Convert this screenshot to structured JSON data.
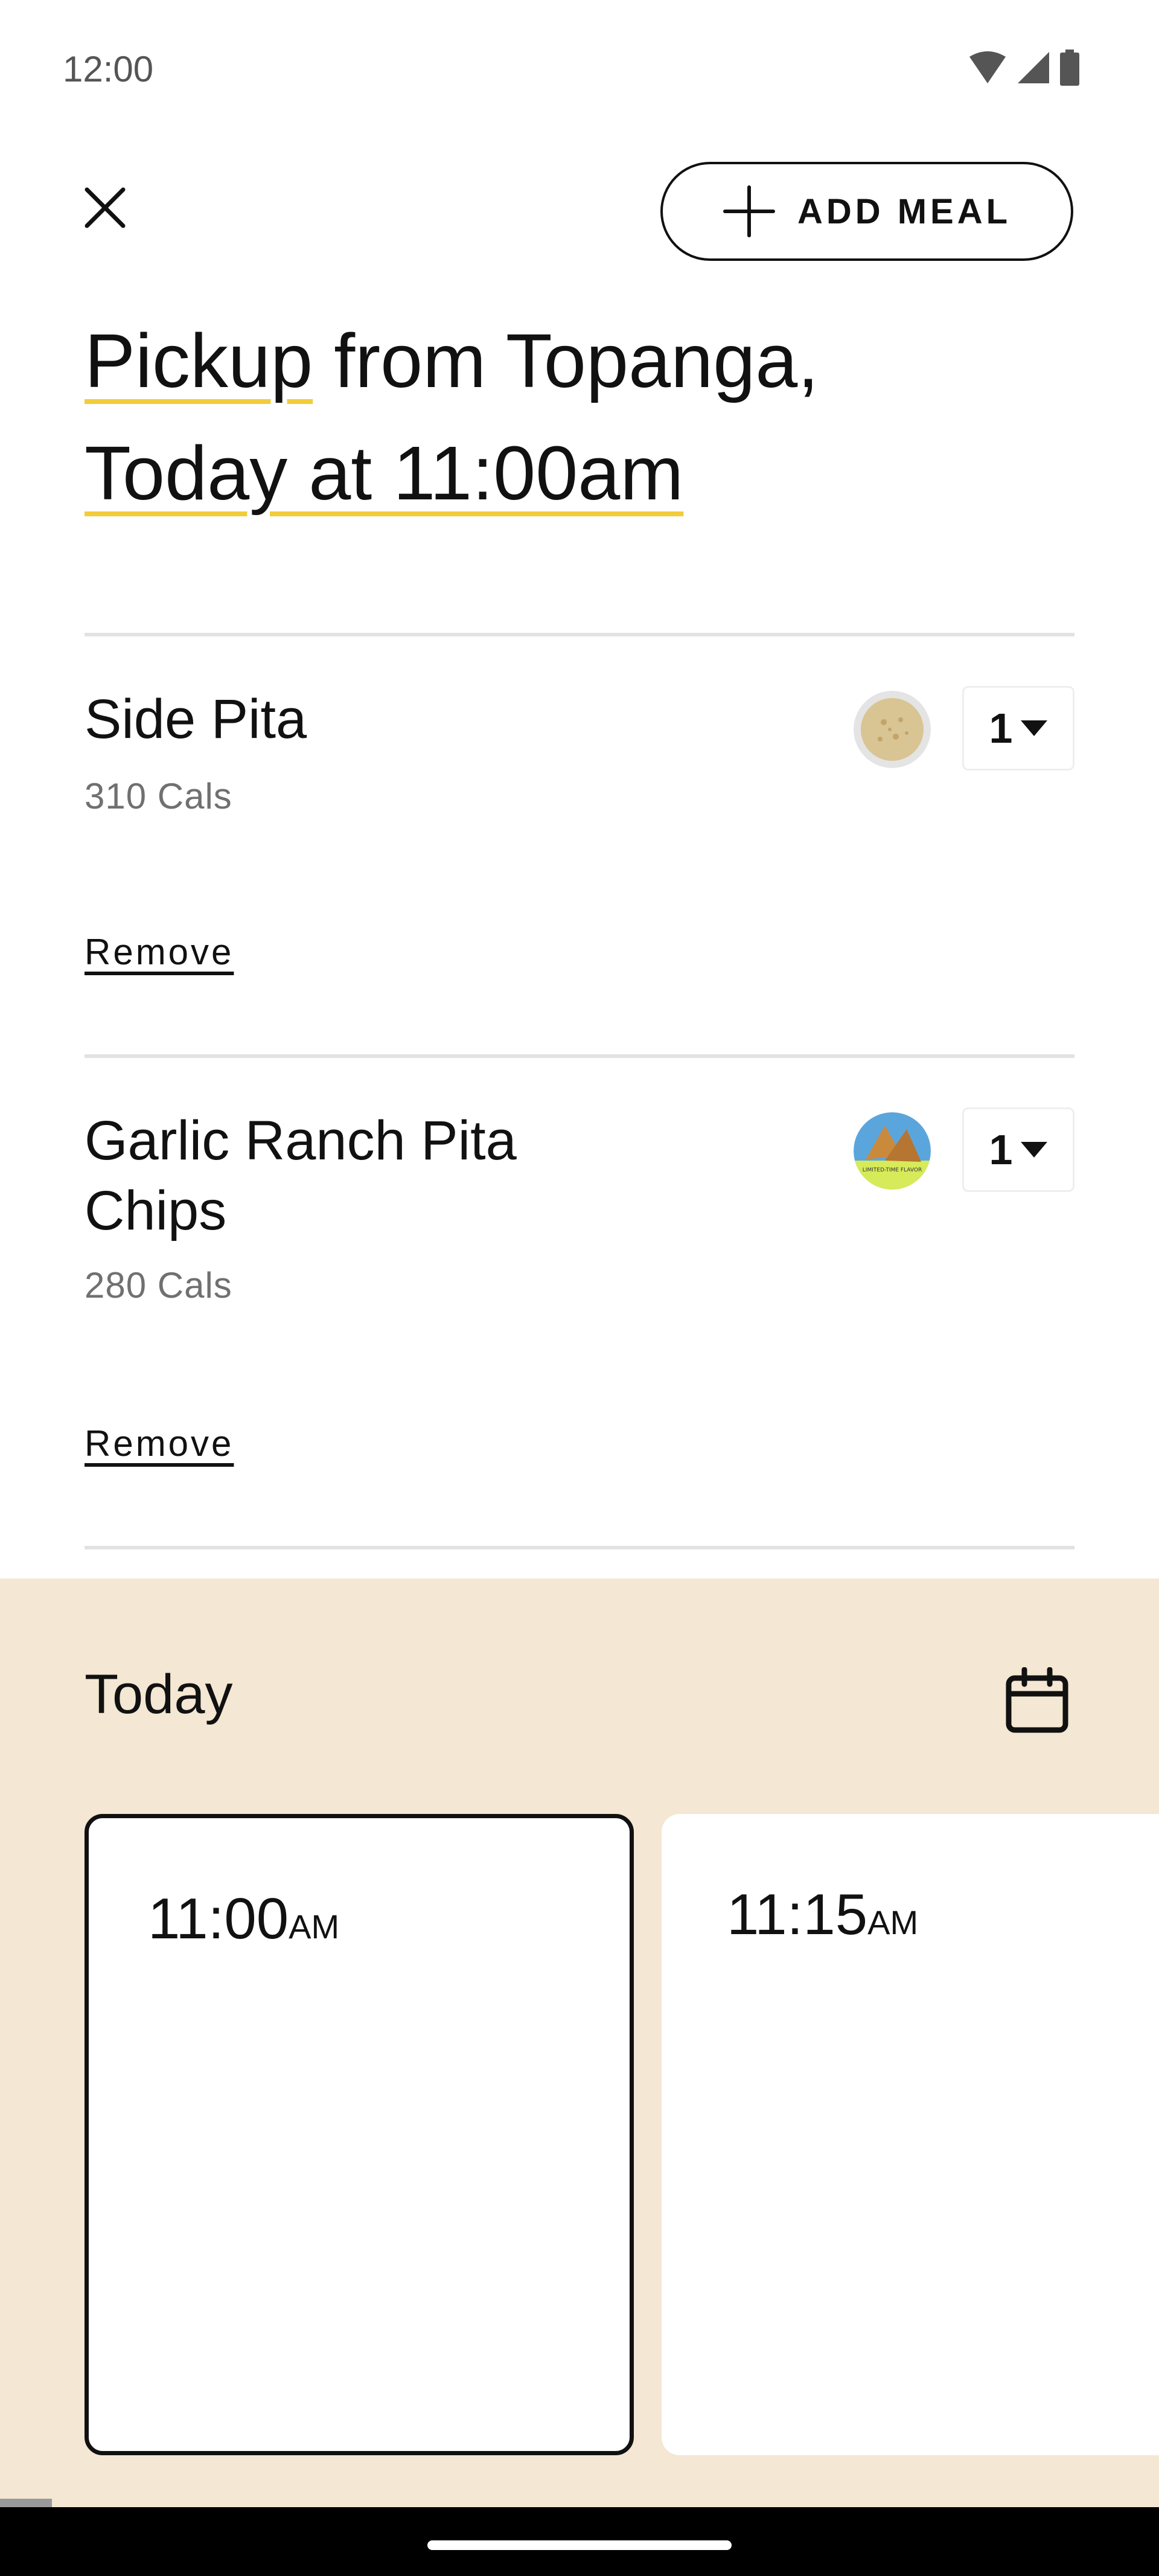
{
  "status_bar": {
    "time": "12:00"
  },
  "header": {
    "add_meal_label": "ADD MEAL"
  },
  "title": {
    "part1": "Pickup",
    "part2": " from Topanga,",
    "part3": "Today at 11:00am"
  },
  "order_items": [
    {
      "name": "Side Pita",
      "calories": "310 Cals",
      "quantity": "1",
      "remove_label": "Remove"
    },
    {
      "name_line1": "Garlic Ranch Pita",
      "name_line2": "Chips",
      "calories": "280 Cals",
      "quantity": "1",
      "remove_label": "Remove",
      "badge_text": "LIMITED-TIME FLAVOR"
    }
  ],
  "scheduler": {
    "day_label": "Today",
    "slots": [
      {
        "time": "11:00",
        "ampm": "AM",
        "selected": true
      },
      {
        "time": "11:15",
        "ampm": "AM",
        "selected": false
      }
    ]
  },
  "colors": {
    "accent_underline": "#f2cc3b",
    "scheduler_bg": "#f4e7d3",
    "divider": "#e2e2e2",
    "secondary_text": "#707070"
  }
}
